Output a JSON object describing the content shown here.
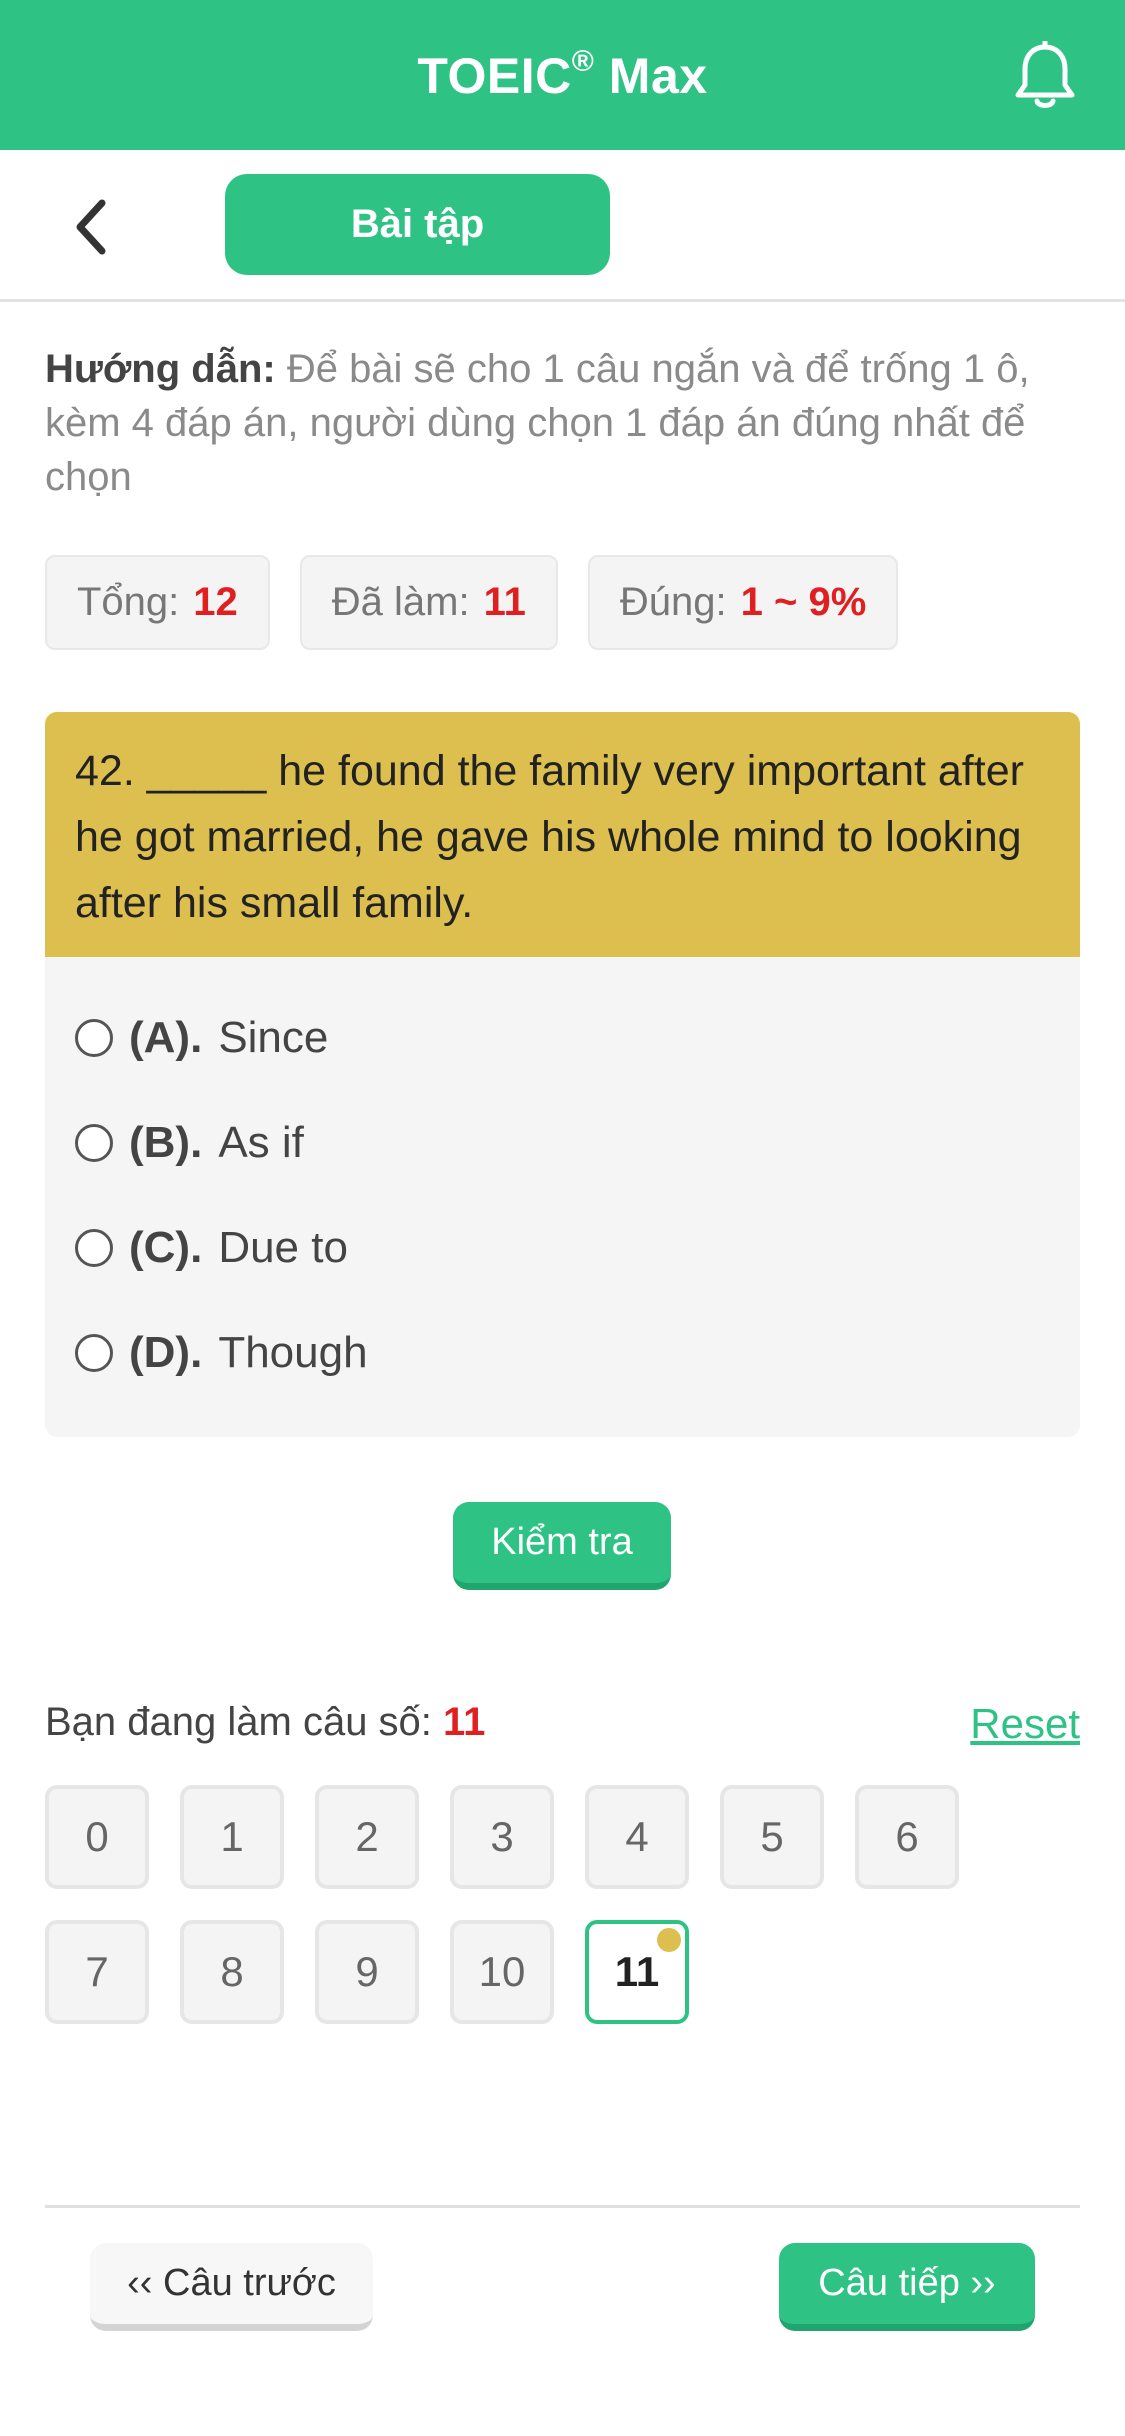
{
  "header": {
    "title": "TOEIC",
    "title_sup": "®",
    "title_suffix": " Max",
    "bell_icon": "bell-icon"
  },
  "subbar": {
    "back_icon": "chevron-left-icon",
    "tab_label": "Bài tập"
  },
  "instructions": {
    "label": "Hướng dẫn:",
    "text": " Để bài sẽ cho 1 câu ngắn và để trống 1 ô, kèm 4 đáp án, người dùng chọn 1 đáp án đúng nhất để chọn"
  },
  "stats": {
    "total_label": "Tổng:",
    "total_value": "12",
    "done_label": "Đã làm:",
    "done_value": "11",
    "correct_label": "Đúng:",
    "correct_value": "1 ~ 9%"
  },
  "question": {
    "text": "42. _____ he found the family very important after he got married, he gave his whole mind to looking after his small family.",
    "options": [
      {
        "key": "(A).",
        "text": "Since"
      },
      {
        "key": "(B).",
        "text": "As if"
      },
      {
        "key": "(C).",
        "text": "Due to"
      },
      {
        "key": "(D).",
        "text": "Though"
      }
    ]
  },
  "check_button": "Kiểm tra",
  "progress": {
    "label": "Bạn đang làm câu số: ",
    "current": "11",
    "reset": "Reset",
    "numbers": [
      "0",
      "1",
      "2",
      "3",
      "4",
      "5",
      "6",
      "7",
      "8",
      "9",
      "10",
      "11"
    ]
  },
  "footer": {
    "prev": "‹‹ Câu trước",
    "next": "Câu tiếp ››"
  },
  "colors": {
    "brand": "#2ec385",
    "question_bg": "#dcbf4e",
    "highlight_red": "#e02020"
  }
}
